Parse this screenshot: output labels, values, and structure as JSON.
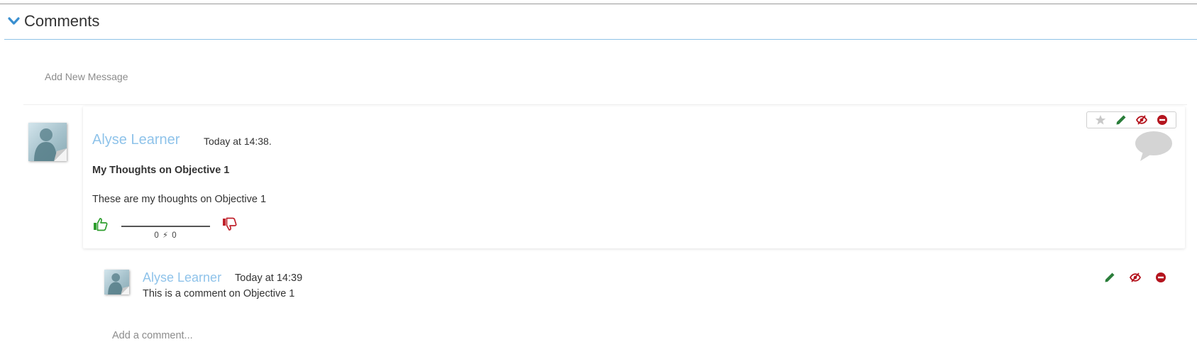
{
  "section": {
    "title": "Comments",
    "collapse_icon": "chevron-down-icon",
    "accent_color": "#3a8fd0"
  },
  "composer": {
    "add_message_label": "Add New Message"
  },
  "message": {
    "author": "Alyse Learner",
    "timestamp": "Today at 14:38.",
    "title": "My Thoughts on Objective 1",
    "body": "These are my thoughts on Objective 1",
    "votes": {
      "up": 0,
      "down": 0,
      "display": "0 ⚡ 0",
      "up_icon": "thumbs-up-icon",
      "down_icon": "thumbs-down-icon"
    },
    "actions": [
      {
        "name": "favorite",
        "icon": "star-icon"
      },
      {
        "name": "edit",
        "icon": "pencil-icon"
      },
      {
        "name": "hide",
        "icon": "eye-slash-icon"
      },
      {
        "name": "delete",
        "icon": "minus-circle-icon"
      }
    ],
    "comment_indicator_icon": "speech-bubble-icon"
  },
  "replies": [
    {
      "author": "Alyse Learner",
      "timestamp": "Today at 14:39",
      "body": "This is a comment on Objective 1",
      "actions": [
        {
          "name": "edit",
          "icon": "pencil-icon"
        },
        {
          "name": "hide",
          "icon": "eye-slash-icon"
        },
        {
          "name": "delete",
          "icon": "minus-circle-icon"
        }
      ]
    }
  ],
  "reply_composer": {
    "placeholder": "Add a comment..."
  },
  "colors": {
    "author_link": "#8fc3ea",
    "like": "#2e9e2e",
    "dislike": "#c0222c",
    "edit": "#2a7d3a",
    "danger": "#b4141e",
    "star_inactive": "#c8c8c8"
  }
}
